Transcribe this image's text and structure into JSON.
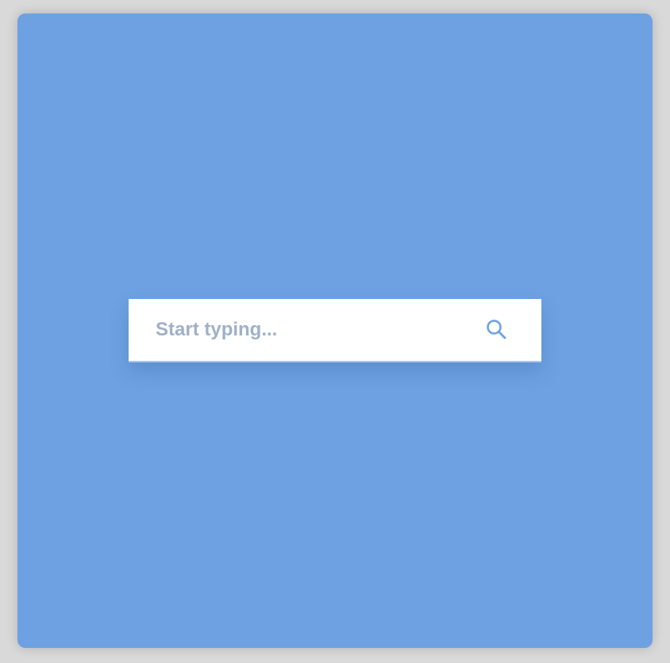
{
  "colors": {
    "card_background": "#6da1e2",
    "accent": "#6da1e2",
    "placeholder": "#9fb1c8"
  },
  "search": {
    "value": "",
    "placeholder": "Start typing...",
    "icon": "search-icon"
  }
}
